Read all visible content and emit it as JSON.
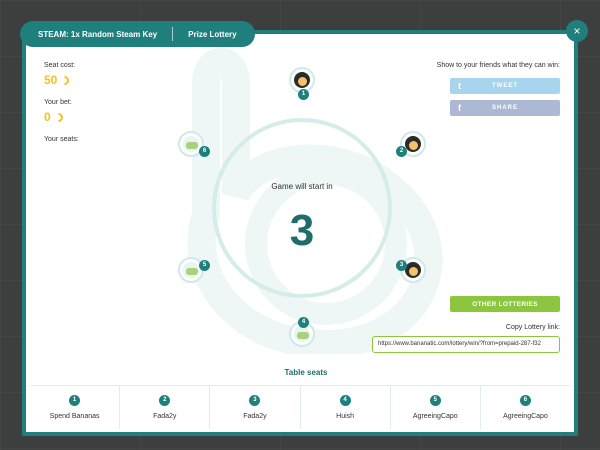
{
  "tabs": [
    {
      "label": "STEAM: 1x Random Steam Key"
    },
    {
      "label": "Prize Lottery"
    }
  ],
  "close_icon": "×",
  "stats": {
    "seat_cost_label": "Seat cost:",
    "seat_cost_value": "50",
    "your_bet_label": "Your bet:",
    "your_bet_value": "0",
    "your_seats_label": "Your seats:"
  },
  "game": {
    "label": "Game will start in",
    "countdown": "3"
  },
  "seats": [
    {
      "number": "1",
      "avatar": "filled"
    },
    {
      "number": "2",
      "avatar": "filled"
    },
    {
      "number": "3",
      "avatar": "filled"
    },
    {
      "number": "4",
      "avatar": "empty"
    },
    {
      "number": "5",
      "avatar": "empty"
    },
    {
      "number": "6",
      "avatar": "empty"
    }
  ],
  "table_seats_label": "Table seats",
  "share": {
    "label": "Show to your friends what they can win:",
    "tweet_label": "TWEET",
    "share_label": "SHARE",
    "tweet_color": "#a9d4ee",
    "share_color": "#adb8d5"
  },
  "other_lotteries_label": "OTHER LOTTERIES",
  "copy_link": {
    "label": "Copy Lottery link:",
    "value": "https://www.bananatic.com/lottery/win/?from=prepaid-287-f32"
  },
  "seat_table": [
    {
      "number": "1",
      "name": "Spend Bananas"
    },
    {
      "number": "2",
      "name": "Fada2y"
    },
    {
      "number": "3",
      "name": "Fada2y"
    },
    {
      "number": "4",
      "name": "Huish"
    },
    {
      "number": "5",
      "name": "AgreeingCapo"
    },
    {
      "number": "6",
      "name": "AgreeingCapo"
    }
  ],
  "colors": {
    "accent": "#1f7f7d",
    "banana": "#f2c21b",
    "green": "#8cc63f"
  }
}
